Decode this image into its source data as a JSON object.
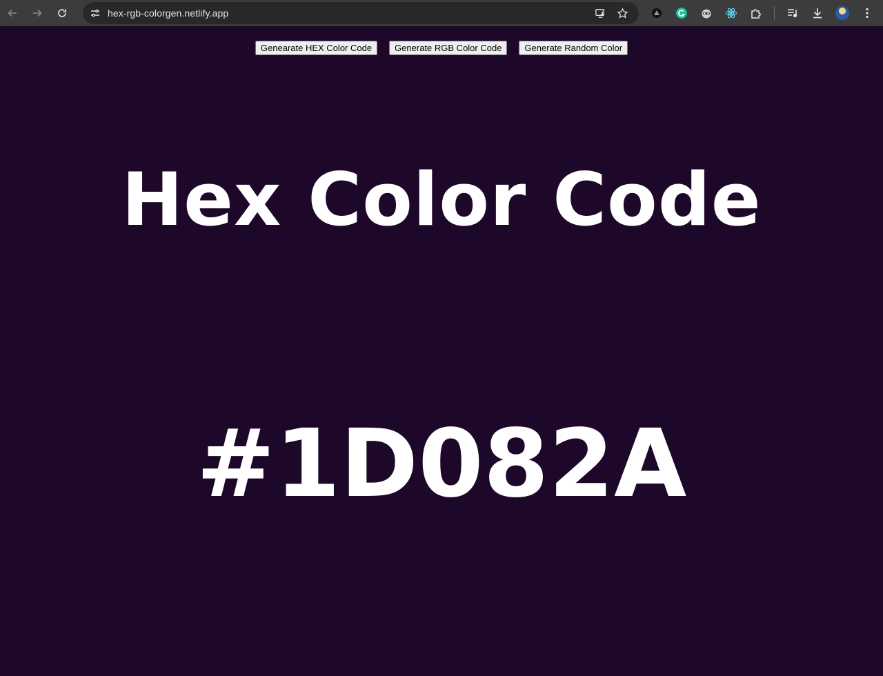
{
  "browser": {
    "url": "hex-rgb-colorgen.netlify.app",
    "icons": {
      "back": "back-arrow-icon",
      "forward": "forward-arrow-icon",
      "reload": "reload-icon",
      "site_info": "site-settings-icon",
      "install": "install-app-icon",
      "bookmark": "star-icon",
      "extensions": [
        "privacy-badger-icon",
        "grammarly-icon",
        "raccoon-extension-icon",
        "react-devtools-icon",
        "puzzle-extensions-icon"
      ],
      "media": "media-queue-icon",
      "downloads": "download-icon",
      "profile": "avatar",
      "menu": "kebab-menu-icon"
    }
  },
  "page": {
    "background_color": "#1d082a",
    "buttons": {
      "hex": "Genearate HEX Color Code",
      "rgb": "Generate RGB Color Code",
      "random": "Generate Random Color"
    },
    "heading": "Hex Color Code",
    "color_value": "#1D082A"
  }
}
